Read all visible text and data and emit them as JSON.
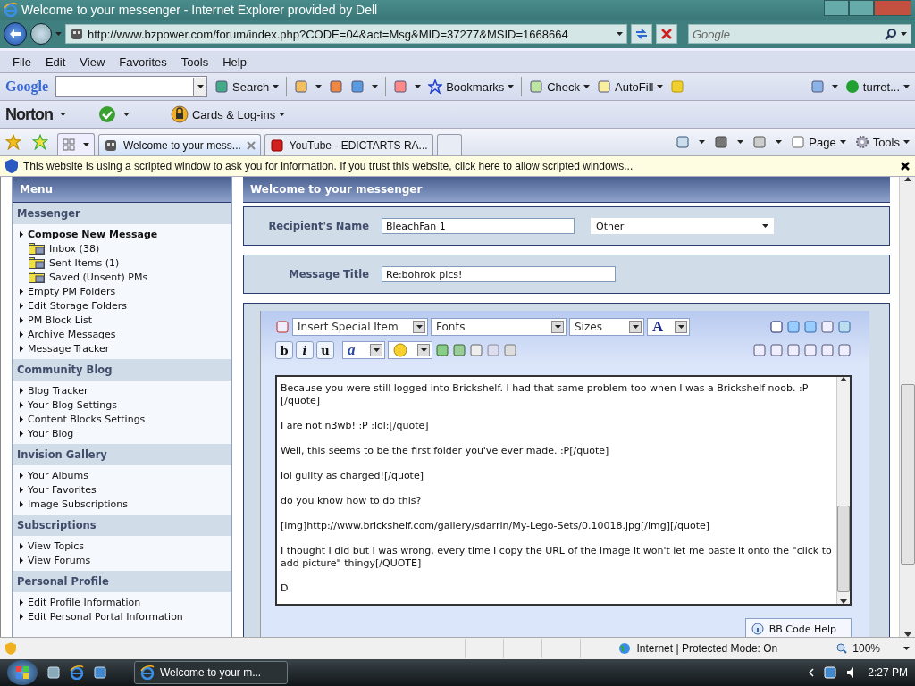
{
  "window": {
    "title": "Welcome to your messenger - Internet Explorer provided by Dell"
  },
  "address_bar": {
    "url": "http://www.bzpower.com/forum/index.php?CODE=04&act=Msg&MID=37277&MSID=1668664",
    "search_placeholder": "Google"
  },
  "menu_bar": [
    "File",
    "Edit",
    "View",
    "Favorites",
    "Tools",
    "Help"
  ],
  "google_toolbar": {
    "logo": "Google",
    "search": "Search",
    "bookmarks": "Bookmarks",
    "check": "Check",
    "autofill": "AutoFill",
    "account": "turret..."
  },
  "norton_toolbar": {
    "logo": "Norton",
    "cards": "Cards & Log-ins"
  },
  "tabs": [
    {
      "label": "Welcome to your mess...",
      "selected": true
    },
    {
      "label": "YouTube - EDICTARTS RA...",
      "selected": false
    }
  ],
  "command_bar": {
    "page": "Page",
    "tools": "Tools"
  },
  "info_bar": {
    "text": "This website is using a scripted window to ask you for information. If you trust this website, click here to allow scripted windows..."
  },
  "sidebar": {
    "title": "Menu",
    "sections": [
      {
        "title": "Messenger",
        "items": [
          {
            "label": "Compose New Message",
            "kind": "bold"
          },
          {
            "label": "Inbox (38)",
            "kind": "folder"
          },
          {
            "label": "Sent Items (1)",
            "kind": "folder"
          },
          {
            "label": "Saved (Unsent) PMs",
            "kind": "folder"
          },
          {
            "label": "Empty PM Folders",
            "kind": "link"
          },
          {
            "label": "Edit Storage Folders",
            "kind": "link"
          },
          {
            "label": "PM Block List",
            "kind": "link"
          },
          {
            "label": "Archive Messages",
            "kind": "link"
          },
          {
            "label": "Message Tracker",
            "kind": "link"
          }
        ]
      },
      {
        "title": "Community Blog",
        "items": [
          {
            "label": "Blog Tracker",
            "kind": "link"
          },
          {
            "label": "Your Blog Settings",
            "kind": "link"
          },
          {
            "label": "Content Blocks Settings",
            "kind": "link"
          },
          {
            "label": "Your Blog",
            "kind": "link"
          }
        ]
      },
      {
        "title": "Invision Gallery",
        "items": [
          {
            "label": "Your Albums",
            "kind": "link"
          },
          {
            "label": "Your Favorites",
            "kind": "link"
          },
          {
            "label": "Image Subscriptions",
            "kind": "link"
          }
        ]
      },
      {
        "title": "Subscriptions",
        "items": [
          {
            "label": "View Topics",
            "kind": "link"
          },
          {
            "label": "View Forums",
            "kind": "link"
          }
        ]
      },
      {
        "title": "Personal Profile",
        "items": [
          {
            "label": "Edit Profile Information",
            "kind": "link"
          },
          {
            "label": "Edit Personal Portal Information",
            "kind": "link"
          }
        ]
      }
    ]
  },
  "main": {
    "title": "Welcome to your messenger",
    "recipient": {
      "label": "Recipient's Name",
      "value": "BleachFan 1",
      "contact": "Other"
    },
    "message_title": {
      "label": "Message Title",
      "value": "Re:bohrok pics!"
    },
    "editor": {
      "dropdowns": [
        "Insert Special Item",
        "Fonts",
        "Sizes"
      ],
      "color_button": "A",
      "format_buttons": [
        "b",
        "i",
        "u"
      ],
      "font_button": "a",
      "body": [
        "Because you were still logged into Brickshelf. I had that same problem too when I was a Brickshelf noob. :P [/quote]",
        "I are not n3wb!  :P  :lol:[/quote]",
        "Well, this seems to be the first folder you've ever made. :P[/quote]",
        "lol guilty as charged![/quote]",
        "do you know how to do this?",
        "[img]http://www.brickshelf.com/gallery/sdarrin/My-Lego-Sets/0.10018.jpg[/img][/quote]",
        "I thought I did but I was wrong, every time I copy the URL of the image it won't let me paste it onto the \"click to add picture\" thingy[/QUOTE]",
        "D"
      ],
      "help_button": "BB Code Help"
    }
  },
  "status_bar": {
    "zone": "Internet | Protected Mode: On",
    "zoom": "100%"
  },
  "taskbar": {
    "window": "Welcome to your m...",
    "time": "2:27 PM"
  }
}
